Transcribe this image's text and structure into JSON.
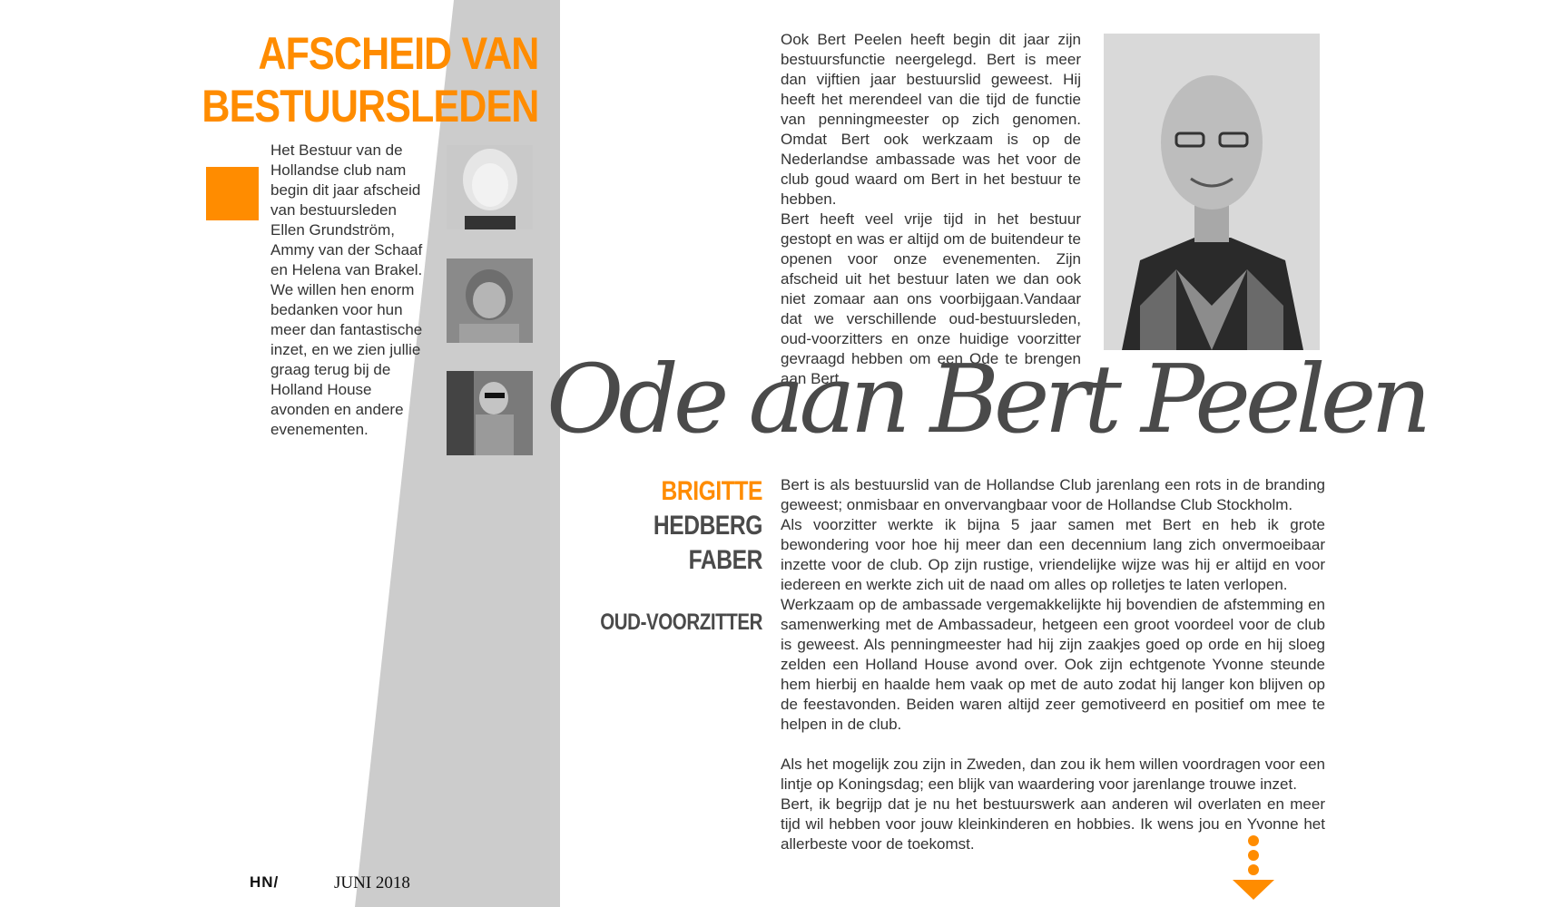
{
  "headline": {
    "line1": "AFSCHEID VAN",
    "line2": "BESTUURSLEDEN"
  },
  "intro": "Het Bestuur van de Hollandse club nam begin dit jaar afscheid van bestuursleden Ellen Grundström, Ammy van der Schaaf en Helena van Brakel. We willen hen enorm bedanken voor hun meer dan fantastische inzet, en we zien jullie graag terug bij de Holland House avonden en andere evenementen.",
  "bert_intro": [
    "Ook Bert Peelen heeft begin dit jaar zijn bestuursfunctie neergelegd. Bert is meer dan vijftien jaar bestuurslid geweest. Hij heeft het merendeel van die tijd de functie van penningmeester op zich genomen. Omdat Bert ook werkzaam is op de Nederlandse ambassade was het voor de club goud waard om Bert in het bestuur te hebben.",
    "Bert heeft veel vrije tijd in het bestuur gestopt en was er altijd om de buitendeur te openen voor onze evenementen. Zijn afscheid uit het bestuur laten we dan ook niet zomaar aan ons voorbijgaan.Vandaar dat we verschillende oud-bestuursleden, oud-voorzitters en onze huidige voorzitter gevraagd hebben om een Ode te brengen aan Bert."
  ],
  "ode_title": "Ode aan Bert Peelen",
  "author": {
    "first": "BRIGITTE",
    "middle": "HEDBERG",
    "last": "FABER",
    "role": "OUD-VOORZITTER"
  },
  "ode_text": [
    "Bert is als bestuurslid van de Hollandse Club jarenlang een rots in de branding geweest; onmisbaar en onvervangbaar voor de Hollandse Club Stockholm.",
    "Als voorzitter werkte ik bijna 5 jaar samen met Bert en heb ik grote bewondering voor hoe hij meer dan een decennium lang zich onvermoeibaar inzette voor de club.  Op zijn rustige, vriendelijke wijze was hij er altijd en voor iedereen en werkte zich uit de naad om alles op rolletjes te laten verlopen.",
    "Werkzaam op de ambassade vergemakkelijkte hij bovendien de afstemming en samenwerking met de Ambassadeur, hetgeen een groot voordeel voor de club is geweest.  Als penningmeester had hij zijn zaakjes goed op orde en hij sloeg zelden een Holland House avond over. Ook zijn echtgenote Yvonne steunde hem hierbij en haalde hem vaak op met de auto zodat hij langer kon blijven op de feestavonden. Beiden waren altijd zeer gemotiveerd en positief om mee te helpen in de club.",
    "Als het mogelijk zou zijn in Zweden, dan zou ik hem willen voordragen voor een lintje op Koningsdag; een blijk van waardering voor jarenlange trouwe inzet.",
    "Bert, ik begrijp dat je nu het bestuurswerk aan anderen wil overlaten en meer tijd wil hebben voor jouw kleinkinderen en hobbies. Ik wens jou en Yvonne het allerbeste voor de toekomst."
  ],
  "footer": {
    "logo": "HN/",
    "date": "JUNI 2018"
  },
  "colors": {
    "accent": "#ff8c00",
    "band": "#cccccc",
    "title": "#4a4a4a"
  },
  "icons": {
    "next_page": "chevron-down-icon"
  }
}
